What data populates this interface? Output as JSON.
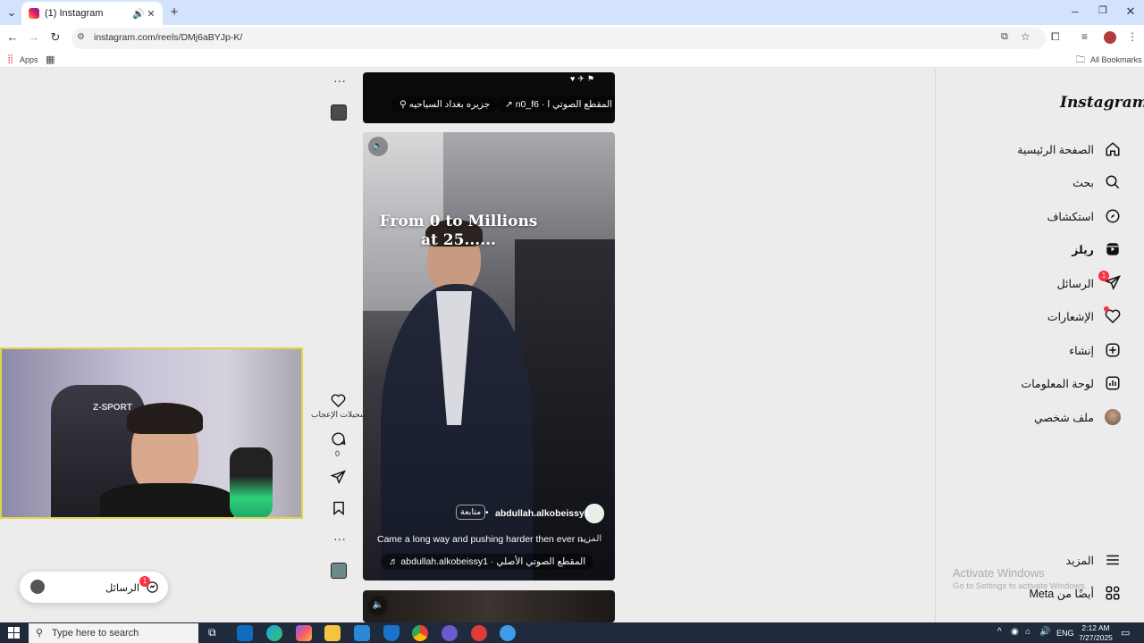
{
  "browser": {
    "tab_title": "(1) Instagram",
    "url": "instagram.com/reels/DMj6aBYJp-K/",
    "bookmarks_apps": "Apps",
    "bookmarks_all": "All Bookmarks"
  },
  "reel_top": {
    "audio_pill": "n0_f6 · المقطع الصوتي ا",
    "location_pill": "جزيره بغداد السياحيه"
  },
  "reel_main": {
    "overlay_text_line1": "From 0 to Millions",
    "overlay_text_line2": "at 25......",
    "username": "abdullah.alkobeissy1",
    "follow_button": "متابعة",
    "caption": "Came a long way and pushing harder then ever n...",
    "caption_more": "المزيد",
    "audio": "abdullah.alkobeissy1 · المقطع الصوتي الأصلي"
  },
  "actions": {
    "likes_label": "سجيلات الإعجاب",
    "comments_count": "0"
  },
  "sidebar": {
    "logo": "Instagram",
    "items": [
      {
        "label": "الصفحة الرئيسية",
        "icon": "home-icon"
      },
      {
        "label": "بحث",
        "icon": "search-icon"
      },
      {
        "label": "استكشاف",
        "icon": "compass-icon"
      },
      {
        "label": "ريلز",
        "icon": "reels-icon"
      },
      {
        "label": "الرسائل",
        "icon": "messages-icon",
        "badge": "1"
      },
      {
        "label": "الإشعارات",
        "icon": "heart-icon"
      },
      {
        "label": "إنشاء",
        "icon": "create-icon"
      },
      {
        "label": "لوحة المعلومات",
        "icon": "dashboard-icon"
      },
      {
        "label": "ملف شخصي",
        "icon": "avatar-icon"
      }
    ],
    "more": "المزيد",
    "also_from_meta": "أيضًا من Meta"
  },
  "messages_pill": {
    "label": "الرسائل",
    "badge": "1"
  },
  "watermark": {
    "line1": "Activate Windows",
    "line2": "Go to Settings to activate Windows."
  },
  "taskbar": {
    "search_placeholder": "Type here to search",
    "lang": "ENG",
    "time": "2:12 AM",
    "date": "7/27/2025"
  },
  "webcam": {
    "chair_brand": "Z-SPORT"
  }
}
